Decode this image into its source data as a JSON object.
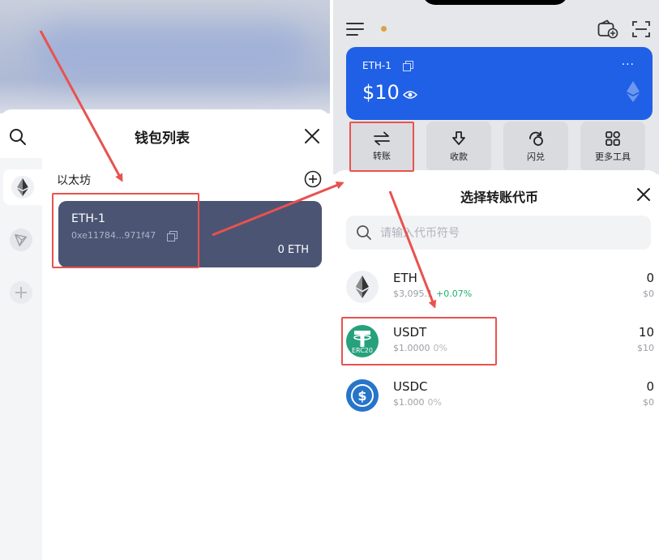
{
  "left_panel": {
    "title": "钱包列表",
    "network_section": "以太坊",
    "wallet": {
      "name": "ETH-1",
      "address": "0xe11784...971f47",
      "balance": "0 ETH"
    },
    "rail_icons": [
      "ethereum-icon",
      "tron-icon",
      "add-network-icon"
    ]
  },
  "right_panel": {
    "account": {
      "name": "ETH-1",
      "value": "$10",
      "more": "···"
    },
    "actions": [
      {
        "label": "转账",
        "icon": "transfer-icon"
      },
      {
        "label": "收款",
        "icon": "receive-icon"
      },
      {
        "label": "闪兑",
        "icon": "swap-icon"
      },
      {
        "label": "更多工具",
        "icon": "more-tools-icon"
      }
    ],
    "sheet_title": "选择转账代币",
    "search_placeholder": "请输入代币符号",
    "tokens": [
      {
        "symbol": "ETH",
        "price": "$3,095.1",
        "change": "+0.07%",
        "amount": "0",
        "fiat": "$0",
        "icon_badge": ""
      },
      {
        "symbol": "USDT",
        "price": "$1.0000",
        "change": "0%",
        "amount": "10",
        "fiat": "$10",
        "icon_badge": "ERC20"
      },
      {
        "symbol": "USDC",
        "price": "$1.000",
        "change": "0%",
        "amount": "0",
        "fiat": "$0",
        "icon_badge": ""
      }
    ]
  },
  "colors": {
    "accent_blue": "#1f60e6",
    "wallet_card": "#4b5473",
    "highlight_red": "#e8524f",
    "positive_green": "#1db26b",
    "usdt_green": "#26a17b",
    "usdc_blue": "#2775ca"
  }
}
